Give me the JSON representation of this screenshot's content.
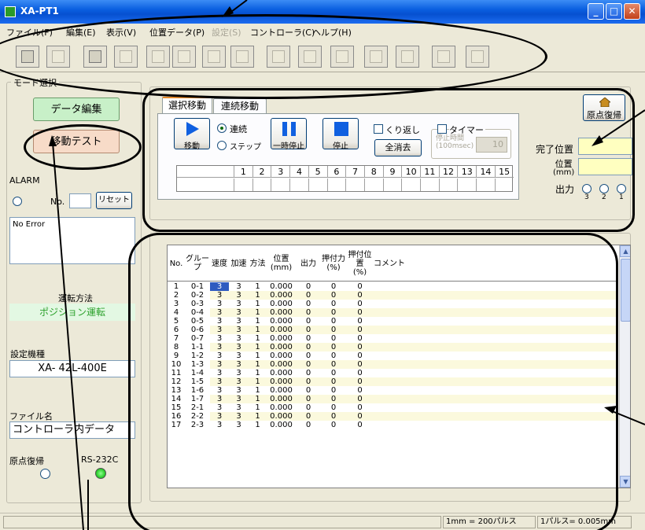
{
  "window": {
    "title": "XA-PT1"
  },
  "menu": [
    "ファイル(F)",
    "編集(E)",
    "表示(V)",
    "位置データ(P)",
    "設定(S)",
    "コントローラ(C)",
    "ヘルプ(H)"
  ],
  "mode": {
    "group_label": "モード選択",
    "data_edit": "データ編集",
    "move_test": "移動テスト"
  },
  "alarm": {
    "label": "ALARM",
    "no_label": "No.",
    "reset": "リセット",
    "message": "No Error"
  },
  "operation": {
    "label": "運転方法",
    "value": "ポジション運転",
    "model_label": "設定機種",
    "model_value": "XA- 42L-400E",
    "file_label": "ファイル名",
    "file_value": "コントローラ内データ",
    "home_label": "原点復帰",
    "rs_label": "RS-232C"
  },
  "tabs": {
    "select": "選択移動",
    "continuous": "連続移動"
  },
  "controls": {
    "move": "移動",
    "radio_continuous": "連続",
    "radio_step": "ステップ",
    "pause": "一時停止",
    "stop": "停止",
    "repeat": "くり返し",
    "clear_all": "全消去",
    "timer": "タイマー",
    "stop_time": "停止時間",
    "stop_time_unit": "(100msec)",
    "timer_value": "10",
    "home_return": "原点復帰",
    "done_pos": "完了位置",
    "position": "位置",
    "position_unit": "(mm)",
    "output": "出力",
    "out_labels": [
      "3",
      "2",
      "1"
    ]
  },
  "step_grid": {
    "numbers": [
      "1",
      "2",
      "3",
      "4",
      "5",
      "6",
      "7",
      "8",
      "9",
      "10",
      "11",
      "12",
      "13",
      "14",
      "15"
    ]
  },
  "table": {
    "headers": [
      "No.",
      "グループ",
      "速度",
      "加速",
      "方法",
      "位置\n(mm)",
      "出力",
      "押付力\n(%)",
      "押付位置\n(%)",
      "コメント"
    ],
    "rows": [
      [
        "1",
        "0-1",
        "3",
        "3",
        "1",
        "0.000",
        "0",
        "0",
        "0"
      ],
      [
        "2",
        "0-2",
        "3",
        "3",
        "1",
        "0.000",
        "0",
        "0",
        "0"
      ],
      [
        "3",
        "0-3",
        "3",
        "3",
        "1",
        "0.000",
        "0",
        "0",
        "0"
      ],
      [
        "4",
        "0-4",
        "3",
        "3",
        "1",
        "0.000",
        "0",
        "0",
        "0"
      ],
      [
        "5",
        "0-5",
        "3",
        "3",
        "1",
        "0.000",
        "0",
        "0",
        "0"
      ],
      [
        "6",
        "0-6",
        "3",
        "3",
        "1",
        "0.000",
        "0",
        "0",
        "0"
      ],
      [
        "7",
        "0-7",
        "3",
        "3",
        "1",
        "0.000",
        "0",
        "0",
        "0"
      ],
      [
        "8",
        "1-1",
        "3",
        "3",
        "1",
        "0.000",
        "0",
        "0",
        "0"
      ],
      [
        "9",
        "1-2",
        "3",
        "3",
        "1",
        "0.000",
        "0",
        "0",
        "0"
      ],
      [
        "10",
        "1-3",
        "3",
        "3",
        "1",
        "0.000",
        "0",
        "0",
        "0"
      ],
      [
        "11",
        "1-4",
        "3",
        "3",
        "1",
        "0.000",
        "0",
        "0",
        "0"
      ],
      [
        "12",
        "1-5",
        "3",
        "3",
        "1",
        "0.000",
        "0",
        "0",
        "0"
      ],
      [
        "13",
        "1-6",
        "3",
        "3",
        "1",
        "0.000",
        "0",
        "0",
        "0"
      ],
      [
        "14",
        "1-7",
        "3",
        "3",
        "1",
        "0.000",
        "0",
        "0",
        "0"
      ],
      [
        "15",
        "2-1",
        "3",
        "3",
        "1",
        "0.000",
        "0",
        "0",
        "0"
      ],
      [
        "16",
        "2-2",
        "3",
        "3",
        "1",
        "0.000",
        "0",
        "0",
        "0"
      ],
      [
        "17",
        "2-3",
        "3",
        "3",
        "1",
        "0.000",
        "0",
        "0",
        "0"
      ]
    ]
  },
  "status": {
    "scale": "1mm = 200パルス",
    "pulse": "1パルス= 0.005mm"
  },
  "colors": {
    "mode_data_edit": "#c8f0c8",
    "mode_move_test": "#f7dbc8",
    "highlight_cell": "#2f5bc0",
    "row_alt": "#fbf9dd",
    "led_green": "#2fcf2f",
    "input_yellow": "#ffffc0"
  }
}
